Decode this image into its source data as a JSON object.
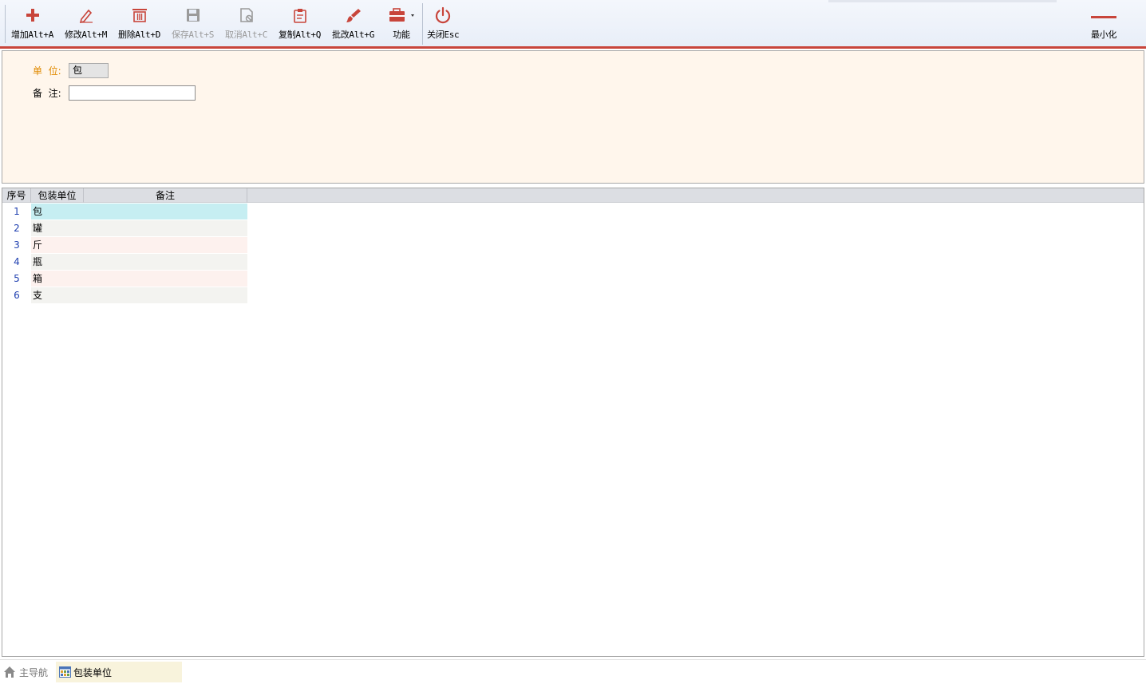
{
  "toolbar": {
    "add": "增加Alt+A",
    "edit": "修改Alt+M",
    "delete": "删除Alt+D",
    "save": "保存Alt+S",
    "cancel": "取消Alt+C",
    "copy": "复制Alt+Q",
    "batch_edit": "批改Alt+G",
    "functions": "功能",
    "close": "关闭Esc",
    "minimize": "最小化",
    "colors": {
      "icon_red": "#c8453b",
      "disabled_gray": "#9a9a9a"
    },
    "icons": [
      "plus-icon",
      "pencil-icon",
      "trash-icon",
      "save-disk-icon",
      "cancel-icon",
      "copy-clipboard-icon",
      "brush-icon",
      "toolbox-icon",
      "power-icon",
      "minimize-icon"
    ]
  },
  "form": {
    "unit_label": "单  位:",
    "unit_value": "包",
    "note_label": "备  注:",
    "note_value": ""
  },
  "grid": {
    "columns": [
      "序号",
      "包装单位",
      "备注"
    ],
    "rows": [
      {
        "num": "1",
        "unit": "包",
        "note": ""
      },
      {
        "num": "2",
        "unit": "罐",
        "note": ""
      },
      {
        "num": "3",
        "unit": "斤",
        "note": ""
      },
      {
        "num": "4",
        "unit": "瓶",
        "note": ""
      },
      {
        "num": "5",
        "unit": "箱",
        "note": ""
      },
      {
        "num": "6",
        "unit": "支",
        "note": ""
      }
    ],
    "colors": {
      "selected": "#c6eef2",
      "odd": "#fdf1ee",
      "even": "#f3f3f0"
    }
  },
  "tabs": {
    "home": "主导航",
    "current": "包装单位"
  }
}
